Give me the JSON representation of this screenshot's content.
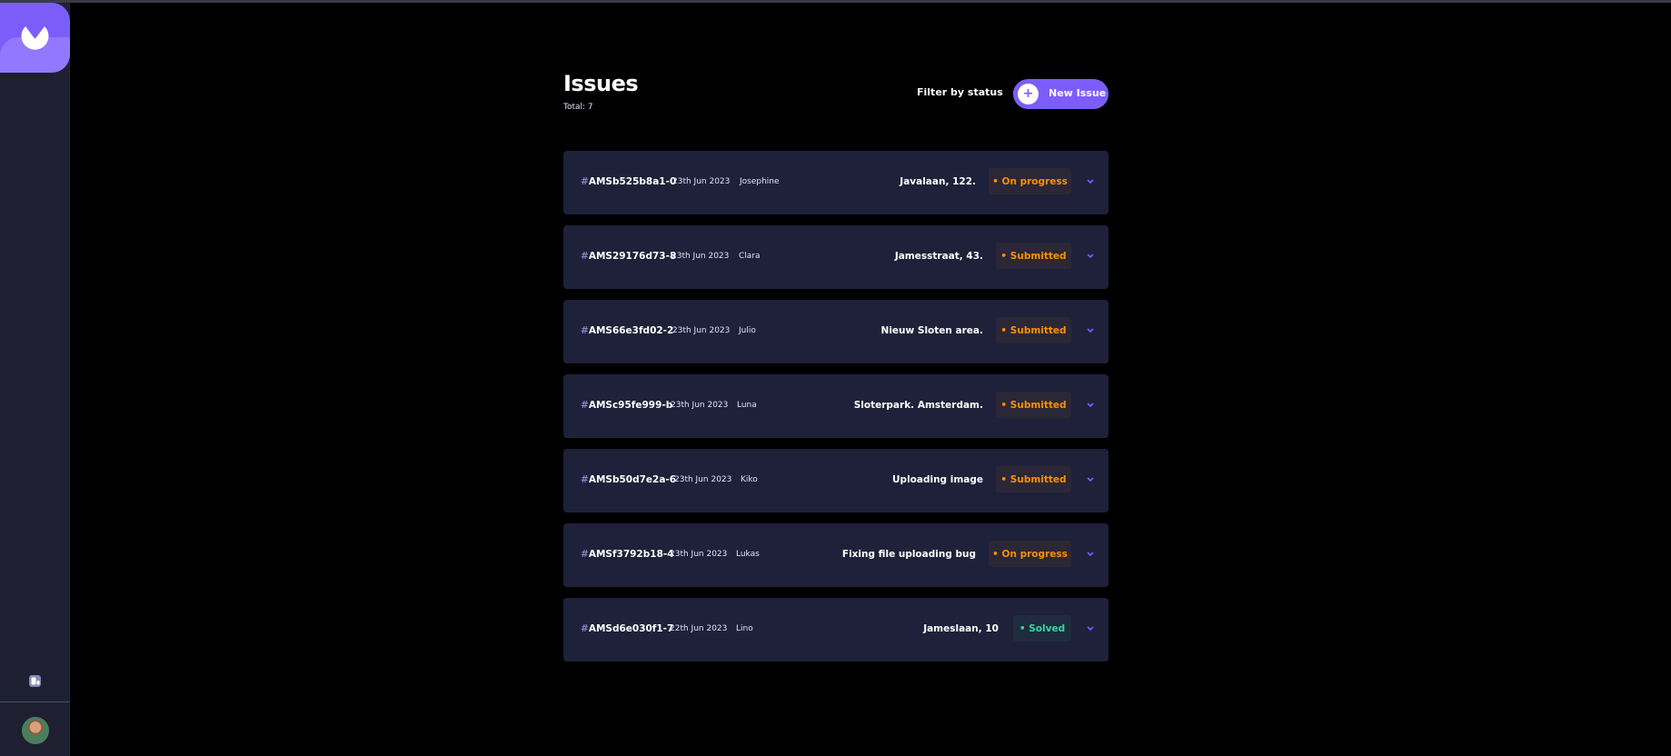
{
  "header": {
    "title": "Issues",
    "total": "Total: 7",
    "filter_label": "Filter by status",
    "new_button_label": "New Issue",
    "new_button_icon": "plus-icon"
  },
  "sidebar": {
    "logo_icon": "app-logo",
    "theme_icon": "theme-toggle-icon",
    "avatar": "user-avatar"
  },
  "colors": {
    "accent": "#7c5dfa",
    "row_bg": "#1e2139",
    "status_orange": "#ff8f00",
    "status_green": "#33d69f"
  },
  "issues": [
    {
      "hash": "#",
      "id": "AMSb525b8a1-0",
      "date": "23th Jun 2023",
      "name": "Josephine",
      "location": "Javalaan, 122.",
      "status": "• On progress"
    },
    {
      "hash": "#",
      "id": "AMS29176d73-8",
      "date": "23th Jun 2023",
      "name": "Clara",
      "location": "Jamesstraat, 43.",
      "status": "• Submitted"
    },
    {
      "hash": "#",
      "id": "AMS66e3fd02-2",
      "date": "23th Jun 2023",
      "name": "Julio",
      "location": "Nieuw Sloten area.",
      "status": "• Submitted"
    },
    {
      "hash": "#",
      "id": "AMSc95fe999-b",
      "date": "23th Jun 2023",
      "name": "Luna",
      "location": "Sloterpark. Amsterdam.",
      "status": "• Submitted"
    },
    {
      "hash": "#",
      "id": "AMSb50d7e2a-6",
      "date": "23th Jun 2023",
      "name": "Kiko",
      "location": "Uploading image",
      "status": "• Submitted"
    },
    {
      "hash": "#",
      "id": "AMSf3792b18-4",
      "date": "23th Jun 2023",
      "name": "Lukas",
      "location": "Fixing file uploading bug",
      "status": "• On progress"
    },
    {
      "hash": "#",
      "id": "AMSd6e030f1-7",
      "date": "22th Jun 2023",
      "name": "Lino",
      "location": "Jameslaan, 10",
      "status": "• Solved"
    }
  ]
}
